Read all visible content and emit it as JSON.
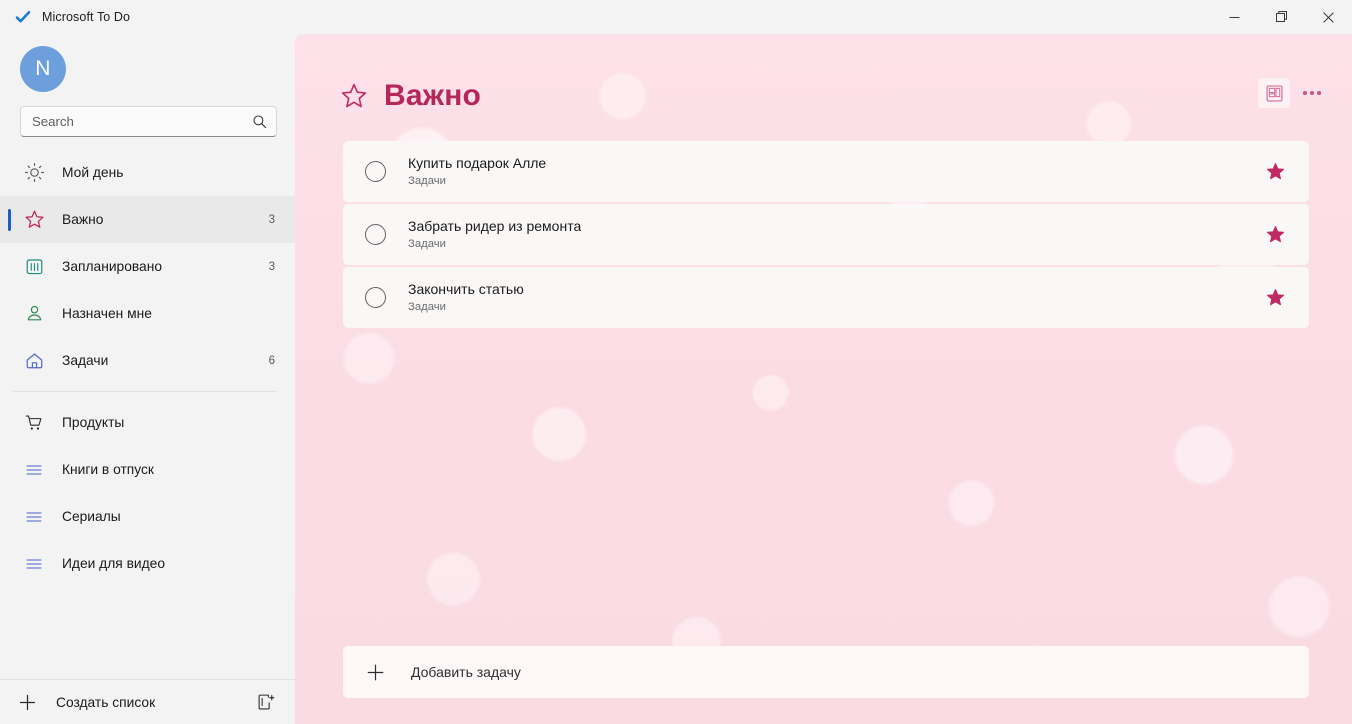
{
  "window": {
    "app_icon": "checkmark-icon",
    "title": "Microsoft To Do",
    "controls": {
      "minimize": "minimize-icon",
      "restore": "restore-icon",
      "close": "close-icon"
    }
  },
  "sidebar": {
    "avatar_initial": "N",
    "search": {
      "placeholder": "Search",
      "value": "",
      "icon": "search-icon"
    },
    "smart_lists": [
      {
        "icon": "sun-icon",
        "icon_color": "#5a5a5a",
        "label": "Мой день",
        "count": ""
      },
      {
        "icon": "star-icon",
        "icon_color": "#c2295e",
        "label": "Важно",
        "count": "3",
        "selected": true
      },
      {
        "icon": "calendar-icon",
        "icon_color": "#1f8b7f",
        "label": "Запланировано",
        "count": "3"
      },
      {
        "icon": "person-icon",
        "icon_color": "#2f8a55",
        "label": "Назначен мне",
        "count": ""
      },
      {
        "icon": "home-icon",
        "icon_color": "#5668c9",
        "label": "Задачи",
        "count": "6"
      }
    ],
    "custom_lists": [
      {
        "icon": "cart-icon",
        "icon_color": "#2b2b2b",
        "label": "Продукты",
        "count": ""
      },
      {
        "icon": "list-icon",
        "icon_color": "#6a7fd0",
        "label": "Книги в отпуск",
        "count": ""
      },
      {
        "icon": "list-icon",
        "icon_color": "#6a7fd0",
        "label": "Сериалы",
        "count": ""
      },
      {
        "icon": "list-icon",
        "icon_color": "#6a7fd0",
        "label": "Идеи для видео",
        "count": ""
      }
    ],
    "footer": {
      "new_list_icon": "plus-icon",
      "new_list_label": "Создать список",
      "new_group_icon": "new-group-icon"
    }
  },
  "main": {
    "header": {
      "icon": "star-outline-icon",
      "title": "Важно",
      "theme_button_icon": "background-picker-icon",
      "more_button_icon": "more-options-icon"
    },
    "tasks": [
      {
        "checkbox": "unchecked-circle-icon",
        "title": "Купить подарок Алле",
        "list": "Задачи",
        "important": true,
        "star_icon": "star-filled-icon"
      },
      {
        "checkbox": "unchecked-circle-icon",
        "title": "Забрать ридер из ремонта",
        "list": "Задачи",
        "important": true,
        "star_icon": "star-filled-icon"
      },
      {
        "checkbox": "unchecked-circle-icon",
        "title": "Закончить статью",
        "list": "Задачи",
        "important": true,
        "star_icon": "star-filled-icon"
      }
    ],
    "add_task": {
      "icon": "plus-icon",
      "label": "Добавить задачу"
    }
  },
  "colors": {
    "accent_blue": "#1c5ec7",
    "title_crimson": "#b5275a",
    "star_crimson": "#bf2a60",
    "panel_pink": "#fcdee6",
    "task_card": "#faf7f7",
    "sidebar_bg": "#f3f3f3"
  }
}
